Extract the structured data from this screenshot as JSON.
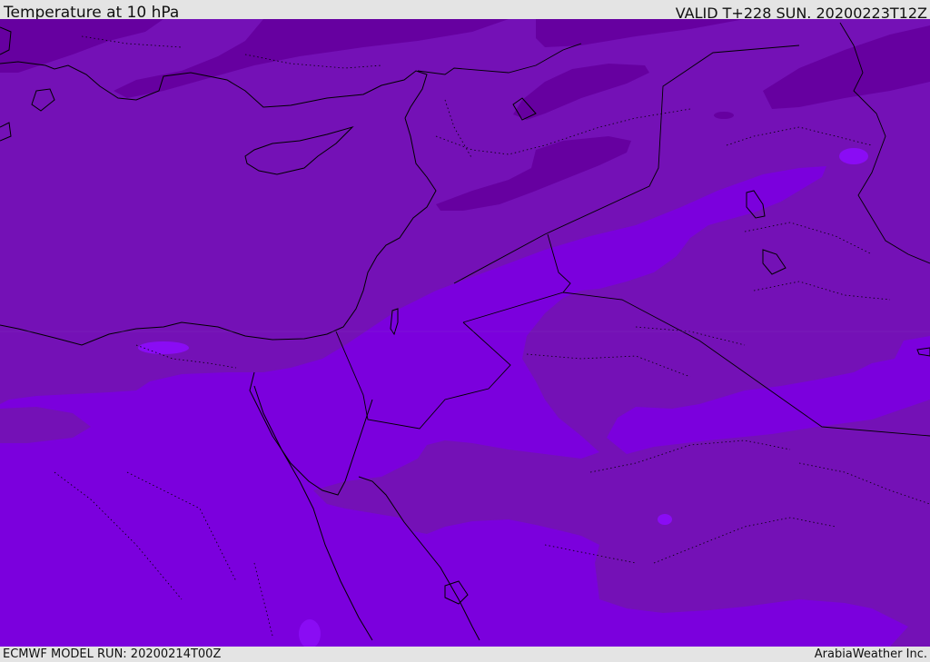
{
  "header": {
    "title": "Temperature at 10 hPa",
    "valid_time": "VALID T+228 SUN. 20200223T12Z"
  },
  "footer": {
    "model_run": "ECMWF MODEL RUN: 20200214T00Z",
    "provider": "ArabiaWeather Inc."
  },
  "colors": {
    "temp_band_warm": "#7b00dd",
    "temp_band_mid": "#7411b6",
    "temp_band_cool": "#6600a0",
    "temp_band_warmest": "#8a0cf4",
    "coastline": "#000000",
    "header_bg": "#e4e4e4"
  }
}
